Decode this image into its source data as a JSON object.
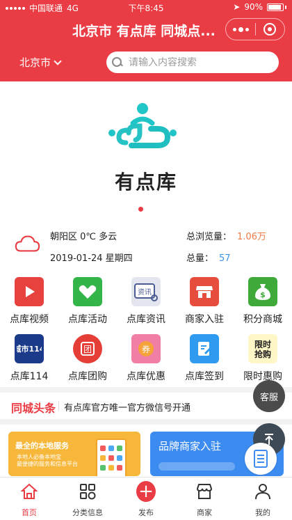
{
  "status_bar": {
    "carrier": "中国联通",
    "network": "4G",
    "time": "下午8:45",
    "battery": "90%"
  },
  "header": {
    "title": "北京市 有点库 同城点...",
    "city": "北京市",
    "search_placeholder": "请输入内容搜索"
  },
  "banner": {
    "brand": "有点库"
  },
  "info": {
    "weather": "朝阳区 0℃ 多云",
    "date": "2019-01-24 星期四",
    "total_views_label": "总浏览量：",
    "total_views": "1.06万",
    "total_label": "总量：",
    "total": "57"
  },
  "grid": [
    {
      "label": "点库视频",
      "icon": "play-icon",
      "color": "#e8423f"
    },
    {
      "label": "点库活动",
      "icon": "handshake-icon",
      "color": "#34b549"
    },
    {
      "label": "点库资讯",
      "icon": "news-icon",
      "color": "#4a5a93"
    },
    {
      "label": "商家入驻",
      "icon": "shop-icon",
      "color": "#e64d3c"
    },
    {
      "label": "积分商城",
      "icon": "money-bag-icon",
      "color": "#3faa3a"
    },
    {
      "label": "点库114",
      "icon": "city-114-icon",
      "color": "#1c3a8a"
    },
    {
      "label": "点库团购",
      "icon": "group-buy-icon",
      "color": "#e53e37"
    },
    {
      "label": "点库优惠",
      "icon": "coupon-icon",
      "color": "#f07ea5"
    },
    {
      "label": "点库签到",
      "icon": "signin-icon",
      "color": "#2f9bf0"
    },
    {
      "label": "限时惠购",
      "icon": "flash-sale-icon",
      "color": "#f2d21f"
    }
  ],
  "headline": {
    "tag": "同城头条",
    "text": "有点库官方唯一官方微信号开通"
  },
  "promo": {
    "left_title": "最全的本地服务",
    "left_sub_1": "本地人必备本地宝",
    "left_sub_2": "最便捷的服务和信息平台",
    "right_title": "品牌商家入驻"
  },
  "floating": {
    "kefu": "客服"
  },
  "tabbar": [
    {
      "label": "首页",
      "icon": "home-icon"
    },
    {
      "label": "分类信息",
      "icon": "category-icon"
    },
    {
      "label": "发布",
      "icon": "plus-icon"
    },
    {
      "label": "商家",
      "icon": "store-icon"
    },
    {
      "label": "我的",
      "icon": "user-icon"
    }
  ],
  "colors": {
    "brand_red": "#ea3c44",
    "accent_orange": "#f07a45",
    "accent_blue": "#3a93e6"
  }
}
